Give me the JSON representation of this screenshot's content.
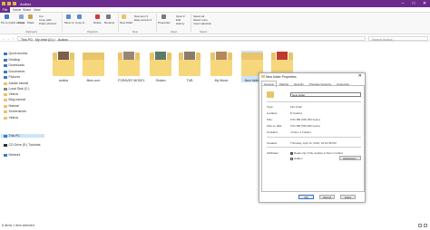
{
  "window": {
    "title": "Audios",
    "quick_access_colors": [
      "#d9b94a",
      "#d9b94a",
      "#d9b94a"
    ]
  },
  "window_buttons": {
    "minimize": "–",
    "maximize": "□",
    "close": "✕"
  },
  "ribbon_tabs": {
    "file": "File",
    "home": "Home",
    "share": "Share",
    "view": "View"
  },
  "ribbon": {
    "pin": "Pin to Quick access",
    "copy": "Copy",
    "paste": "Paste",
    "cut": "Cut",
    "copy_path": "Copy path",
    "paste_shortcut": "Paste shortcut",
    "move_to": "Move to",
    "copy_to": "Copy to",
    "delete": "Delete",
    "rename": "Rename",
    "new_folder": "New folder",
    "new_item": "New item ▾",
    "easy_access": "Easy access ▾",
    "properties": "Properties",
    "open": "Open ▾",
    "edit": "Edit",
    "history": "History",
    "select_all": "Select all",
    "select_none": "Select none",
    "invert_selection": "Invert selection",
    "groups": {
      "clipboard": "Clipboard",
      "organize": "Organize",
      "new": "New",
      "open": "Open",
      "select": "Select"
    }
  },
  "address": {
    "back": "←",
    "forward": "→",
    "up": "↑",
    "crumbs": [
      "This PC",
      "My drive (D:)",
      "Audios"
    ],
    "separator": "›",
    "search_placeholder": "Search Audios"
  },
  "sidebar": {
    "items": [
      {
        "label": "Quick access",
        "color": "#3b78c9"
      },
      {
        "label": "Desktop",
        "color": "#3b78c9"
      },
      {
        "label": "Downloads",
        "color": "#3b78c9"
      },
      {
        "label": "Documents",
        "color": "#3b78c9"
      },
      {
        "label": "Pictures",
        "color": "#3b78c9"
      },
      {
        "label": "Adobe tutorial",
        "color": "#e8c46b"
      },
      {
        "label": "Local Disk (C:)",
        "color": "#888888"
      },
      {
        "label": "Videos",
        "color": "#e8c46b"
      },
      {
        "label": "Blog tutorial",
        "color": "#e8c46b"
      },
      {
        "label": "Natural",
        "color": "#e8c46b"
      },
      {
        "label": "Screenshots",
        "color": "#e8c46b"
      },
      {
        "label": "Videos",
        "color": "#e8c46b"
      },
      {
        "label": "This PC",
        "color": "#3b78c9"
      },
      {
        "label": "CD Drive (E:) Tutorials",
        "color": "#333333"
      },
      {
        "label": "Network",
        "color": "#3b78c9"
      }
    ]
  },
  "folders": [
    {
      "label": "audios",
      "pic": "#7b5f4a"
    },
    {
      "label": "films.com",
      "pic": ""
    },
    {
      "label": "FORAVEZ MODEL",
      "pic": "#9a8675"
    },
    {
      "label": "Sirdam",
      "pic": "#5b7a6a"
    },
    {
      "label": "TUB",
      "pic": "#8a7b6a"
    },
    {
      "label": "My Music",
      "pic": "#b38a5a"
    },
    {
      "label": "New folder",
      "pic": ""
    },
    {
      "label": "Music",
      "pic": "#c0392b"
    }
  ],
  "properties_dialog": {
    "title": "New folder Properties",
    "close": "✕",
    "tabs": [
      "General",
      "Sharing",
      "Security",
      "Previous Versions",
      "Customize"
    ],
    "name_value": "New folder",
    "rows": {
      "type_label": "Type:",
      "type_value": "File folder",
      "location_label": "Location:",
      "location_value": "D:\\Audios",
      "size_label": "Size:",
      "size_value": "0.51 MB (536,394 bytes)",
      "size_on_disk_label": "Size on disk:",
      "size_on_disk_value": "0.51 MB (536,840 bytes)",
      "contains_label": "Contains:",
      "contains_value": "4 Files, 0 Folders",
      "created_label": "Created:",
      "created_value": "Thursday, April 11, 2019, 10:22:38 PM",
      "attributes_label": "Attributes:",
      "readonly_label": "Read-only (Only applies to files in folder)",
      "hidden_label": "Hidden",
      "advanced": "Advanced..."
    },
    "buttons": {
      "ok": "OK",
      "cancel": "Cancel",
      "apply": "Apply"
    }
  },
  "status": {
    "text": "8 items   1 item selected"
  }
}
